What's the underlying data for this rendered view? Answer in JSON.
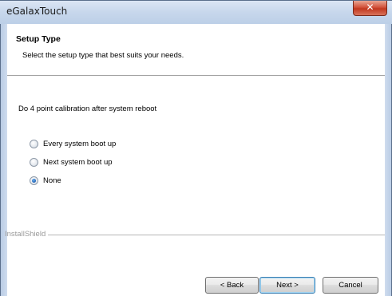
{
  "window": {
    "title": "eGalaxTouch",
    "close_glyph": "✕"
  },
  "header": {
    "title": "Setup Type",
    "subtitle": "Select the setup type that best suits your needs."
  },
  "body": {
    "question": "Do 4 point calibration after system reboot",
    "options": [
      {
        "label": "Every system boot up",
        "checked": false
      },
      {
        "label": "Next system boot up",
        "checked": false
      },
      {
        "label": "None",
        "checked": true
      }
    ]
  },
  "footer": {
    "brand": "InstallShield",
    "back_label": "< Back",
    "next_label": "Next >",
    "cancel_label": "Cancel"
  },
  "colors": {
    "frame": "#bccfe7",
    "close_button": "#c1381f",
    "radio_selected": "#1c5fb3"
  }
}
